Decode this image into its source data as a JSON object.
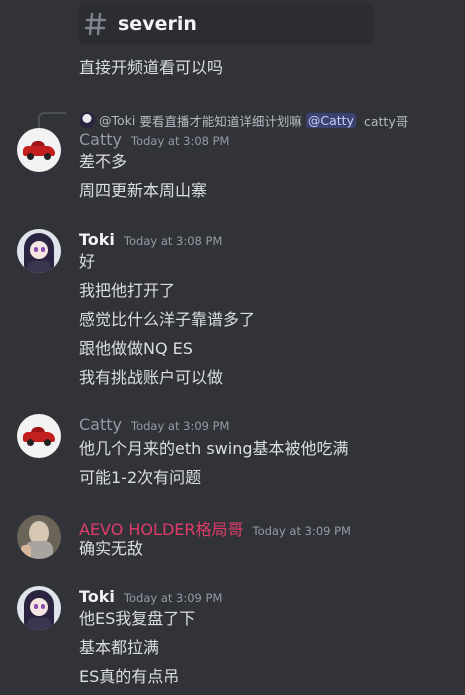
{
  "channel": {
    "name": "severin",
    "icon": "thread-icon"
  },
  "colors": {
    "background": "#313338",
    "aevo_name": "#e03c6a",
    "mention_bg": "#3c4270"
  },
  "messages": [
    {
      "lines": [
        "直接开频道看可以吗"
      ]
    },
    {
      "reply": {
        "author": "@Toki",
        "text": "要看直播才能知道详细计划嘛",
        "mention": "@Catty",
        "trailing": "catty哥"
      },
      "author": "Catty",
      "time": "Today at 3:08 PM",
      "lines": [
        "差不多",
        "周四更新本周山寨"
      ]
    },
    {
      "author": "Toki",
      "time": "Today at 3:08 PM",
      "lines": [
        "好",
        "我把他打开了",
        "感觉比什么洋子靠谱多了",
        "跟他做做NQ ES",
        "我有挑战账户可以做"
      ]
    },
    {
      "author": "Catty",
      "time": "Today at 3:09 PM",
      "lines": [
        "他几个月来的eth swing基本被他吃满",
        "可能1-2次有问题"
      ]
    },
    {
      "author": "AEVO HOLDER格局哥",
      "time": "Today at 3:09 PM",
      "lines": [
        "确实无敌"
      ]
    },
    {
      "author": "Toki",
      "time": "Today at 3:09 PM",
      "lines": [
        "他ES我复盘了下",
        "基本都拉满",
        "ES真的有点吊"
      ]
    }
  ]
}
